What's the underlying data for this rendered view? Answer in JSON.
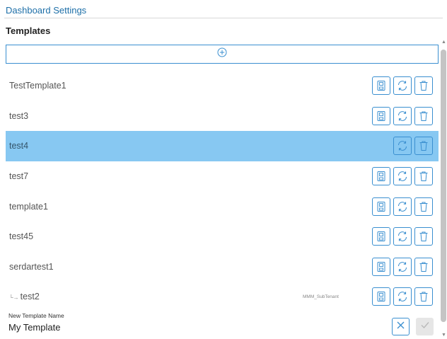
{
  "dialog": {
    "title": "Dashboard Settings",
    "section_title": "Templates"
  },
  "add_button_icon": "plus-circle-icon",
  "templates": [
    {
      "label": "TestTemplate1",
      "selected": false,
      "child": false,
      "tag": "",
      "actions": [
        "save",
        "refresh",
        "delete"
      ]
    },
    {
      "label": "test3",
      "selected": false,
      "child": false,
      "tag": "",
      "actions": [
        "save",
        "refresh",
        "delete"
      ]
    },
    {
      "label": "test4",
      "selected": true,
      "child": false,
      "tag": "",
      "actions": [
        "refresh",
        "delete"
      ]
    },
    {
      "label": "test7",
      "selected": false,
      "child": false,
      "tag": "",
      "actions": [
        "save",
        "refresh",
        "delete"
      ]
    },
    {
      "label": "template1",
      "selected": false,
      "child": false,
      "tag": "",
      "actions": [
        "save",
        "refresh",
        "delete"
      ]
    },
    {
      "label": "test45",
      "selected": false,
      "child": false,
      "tag": "",
      "actions": [
        "save",
        "refresh",
        "delete"
      ]
    },
    {
      "label": "serdartest1",
      "selected": false,
      "child": false,
      "tag": "",
      "actions": [
        "save",
        "refresh",
        "delete"
      ]
    },
    {
      "label": "test2",
      "selected": false,
      "child": true,
      "tag": "MMM_SubTenant",
      "actions": [
        "save",
        "refresh",
        "delete"
      ]
    }
  ],
  "new_template": {
    "label": "New Template Name",
    "value": "My Template"
  },
  "colors": {
    "accent": "#3a8fd0",
    "selected_row": "#87c8f2",
    "title": "#1d6fa8"
  }
}
